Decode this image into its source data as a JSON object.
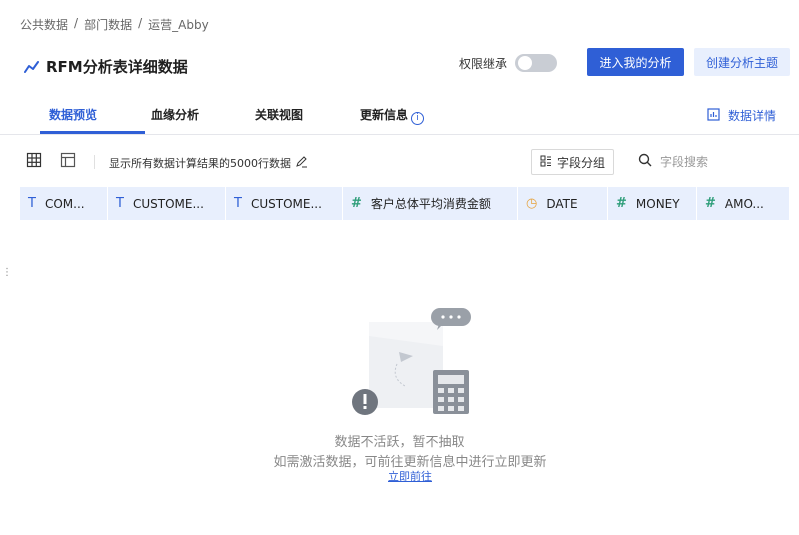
{
  "breadcrumb": [
    "公共数据",
    "部门数据",
    "运营_Abby"
  ],
  "breadcrumb_separator": "/",
  "title": "RFM分析表详细数据",
  "permission_inherit": {
    "label": "权限继承",
    "enabled": false
  },
  "actions": {
    "enter_analysis": "进入我的分析",
    "create_topic": "创建分析主题"
  },
  "tabs": [
    {
      "label": "数据预览",
      "active": true
    },
    {
      "label": "血缘分析",
      "active": false
    },
    {
      "label": "关联视图",
      "active": false
    },
    {
      "label": "更新信息",
      "active": false
    }
  ],
  "data_detail_label": "数据详情",
  "toolbar": {
    "summary": "显示所有数据计算结果的5000行数据",
    "field_group_label": "字段分组",
    "field_search_placeholder": "字段搜索"
  },
  "columns": [
    {
      "type": "text",
      "icon": "T",
      "label": "COM..."
    },
    {
      "type": "text",
      "icon": "T",
      "label": "CUSTOME..."
    },
    {
      "type": "text",
      "icon": "T",
      "label": "CUSTOME..."
    },
    {
      "type": "number",
      "icon": "#",
      "label": "客户总体平均消费金额"
    },
    {
      "type": "date",
      "icon": "◷",
      "label": "DATE"
    },
    {
      "type": "number",
      "icon": "#",
      "label": "MONEY"
    },
    {
      "type": "number",
      "icon": "#",
      "label": "AMO..."
    }
  ],
  "empty_state": {
    "title": "数据不活跃，暂不抽取",
    "description": "如需激活数据，可前往更新信息中进行立即更新",
    "link": "立即前往"
  },
  "colors": {
    "primary": "#2f5fd6",
    "header_bg": "#e8effd",
    "date_icon": "#e6a23c",
    "number_icon": "#2f9e7a"
  }
}
